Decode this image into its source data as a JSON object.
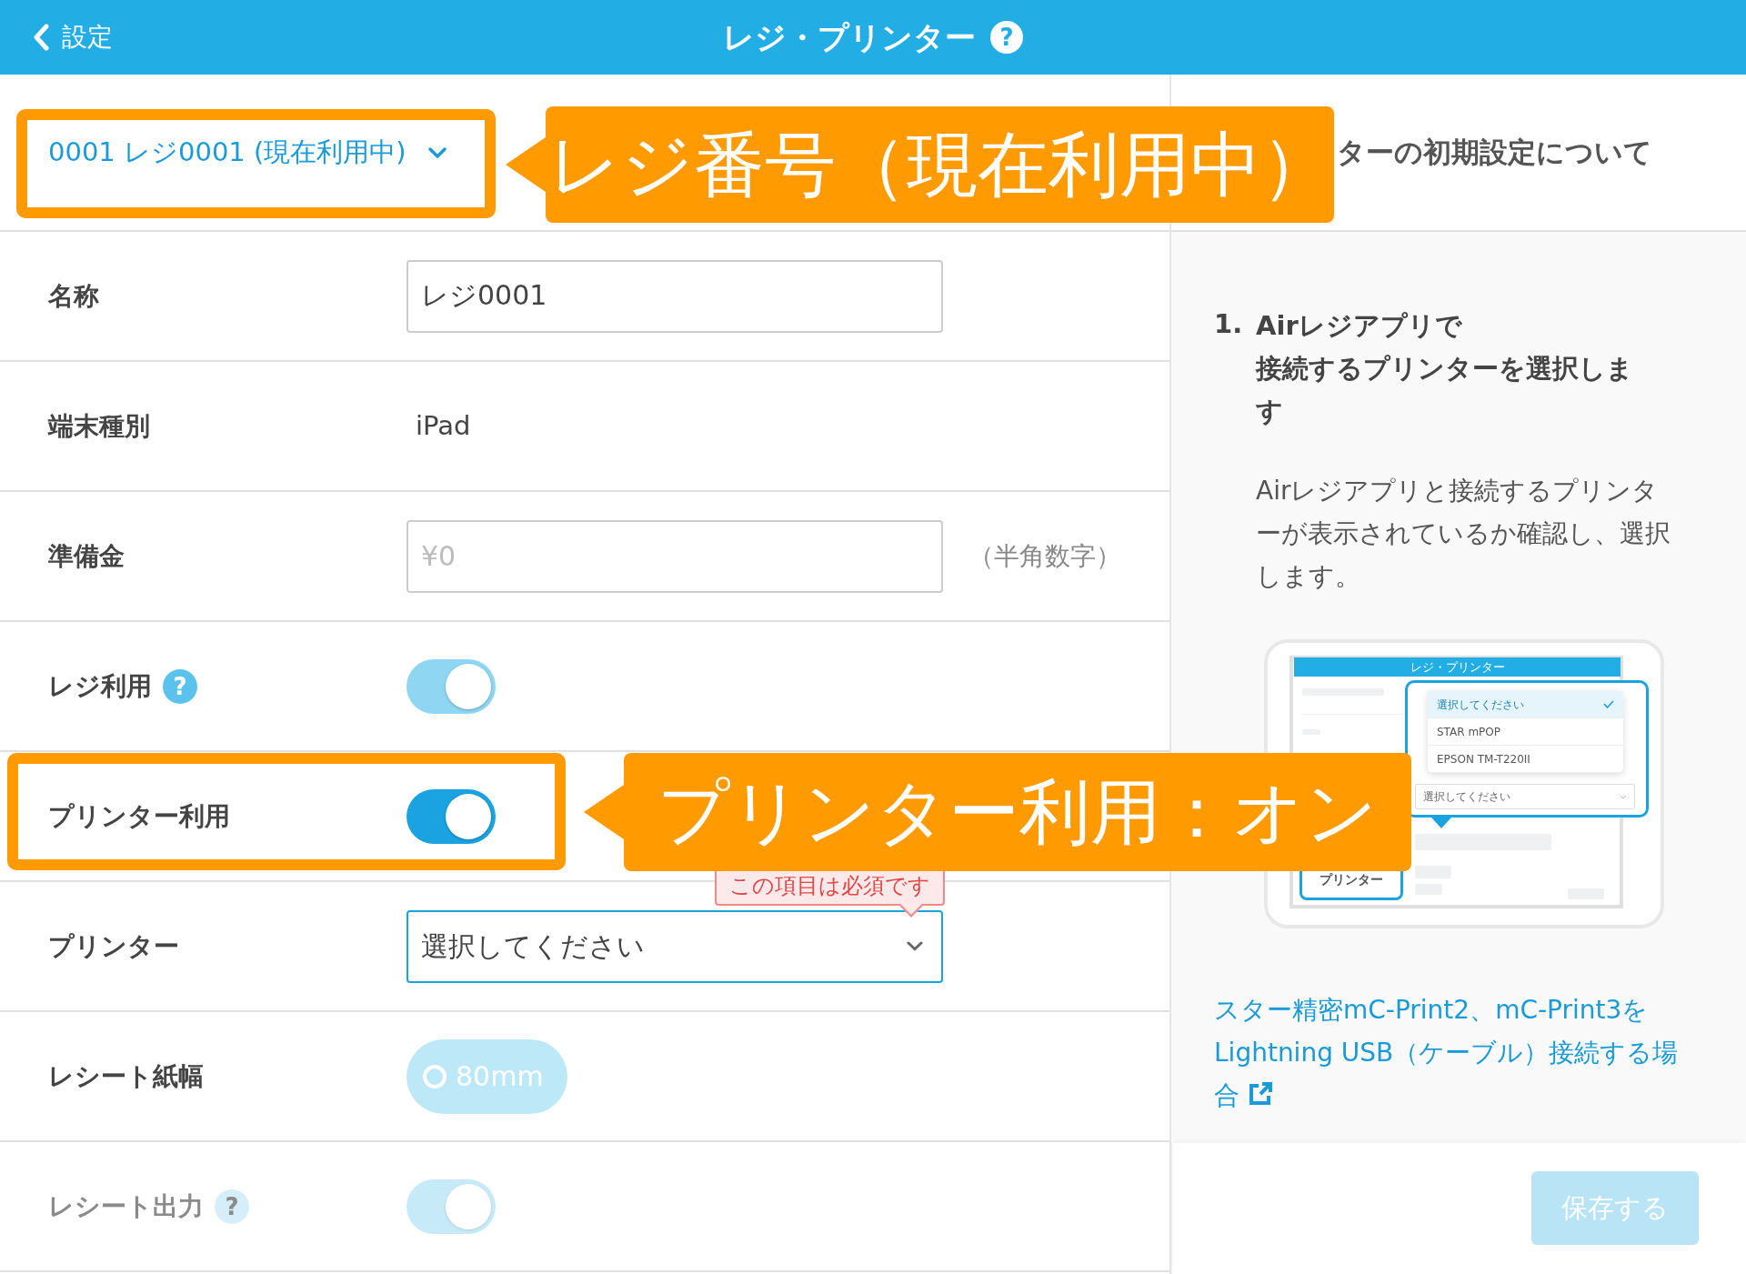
{
  "header": {
    "back_label": "設定",
    "title": "レジ・プリンター",
    "help": "?"
  },
  "register_select": {
    "value": "0001 レジ0001 (現在利用中)"
  },
  "guide_heading": "ターの初期設定について",
  "form_rows": [
    {
      "kind": "input",
      "label": "名称",
      "value": "レジ0001"
    },
    {
      "kind": "text",
      "label": "端末種別",
      "value": "iPad"
    },
    {
      "kind": "input",
      "label": "準備金",
      "placeholder": "¥0",
      "note": "（半角数字）"
    },
    {
      "kind": "toggle",
      "label": "レジ利用",
      "help": "?",
      "on": true,
      "disabled": true
    },
    {
      "kind": "toggle",
      "label": "プリンター利用",
      "on": true,
      "disabled": false
    },
    {
      "kind": "select",
      "label": "プリンター",
      "value": "選択してください",
      "error": "この項目は必須です"
    },
    {
      "kind": "radio",
      "label": "レシート紙幅",
      "options": [
        {
          "label": "80mm",
          "selected": true,
          "disabled": true
        }
      ]
    },
    {
      "kind": "toggle",
      "label": "レシート出力",
      "help": "?",
      "on": true,
      "disabled": true
    }
  ],
  "guide": {
    "steps": [
      {
        "number": "1.",
        "title_lines": [
          "Airレジアプリで",
          "接続するプリンターを選択します"
        ],
        "body": "Airレジアプリと接続するプリンターが表示されているか確認し、選択します。"
      }
    ],
    "illustration": {
      "header_title": "レジ・プリンター",
      "menu_items": [
        {
          "label": "選択してください",
          "selected": true
        },
        {
          "label": "STAR mPOP",
          "selected": false
        },
        {
          "label": "EPSON TM-T220II",
          "selected": false
        }
      ],
      "select_value": "選択してください",
      "field_label": "プリンター"
    },
    "link": "スター精密mC-Print2、mC-Print3をLightning USB（ケーブル）接続する場合"
  },
  "callouts": [
    {
      "text": "レジ番号（現在利用中）"
    },
    {
      "text": "プリンター利用：オン"
    }
  ],
  "footer": {
    "save_button": {
      "label": "保存する",
      "disabled": true
    }
  }
}
